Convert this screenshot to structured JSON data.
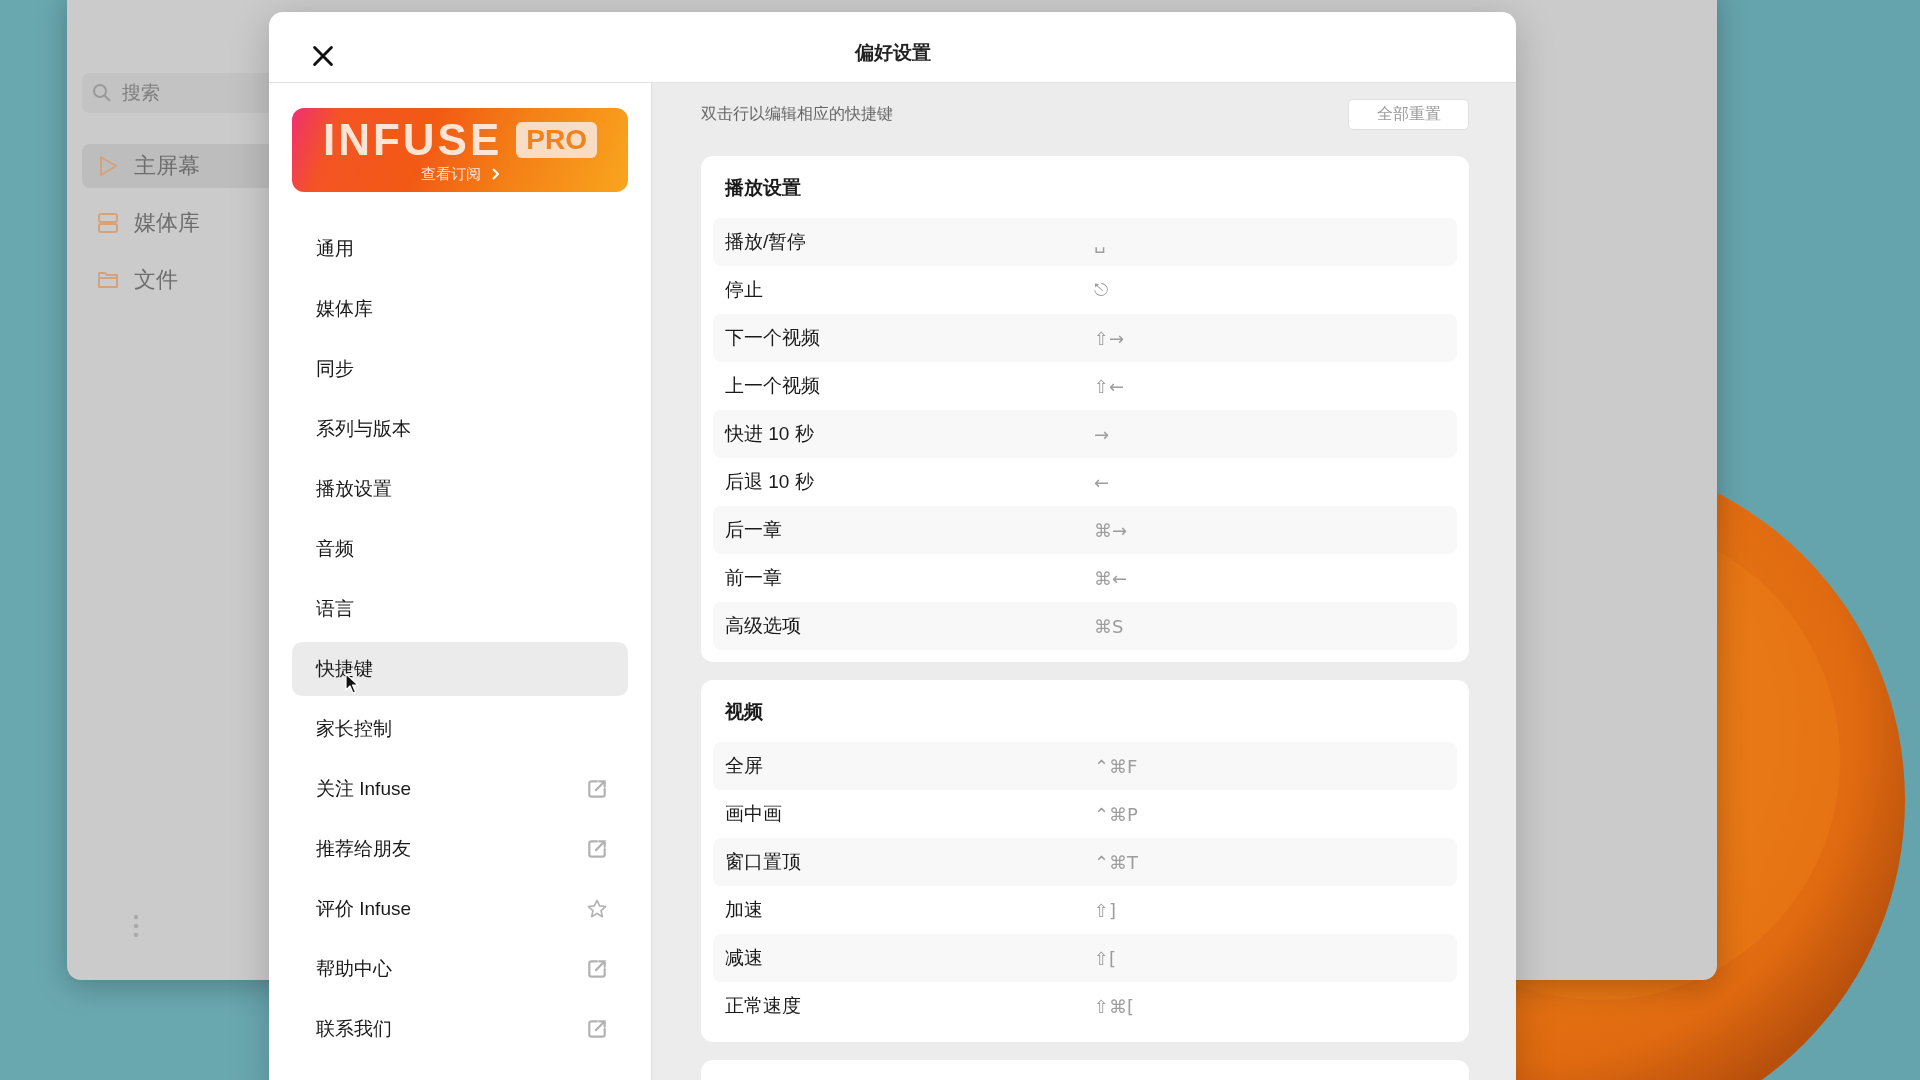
{
  "background_window": {
    "search": {
      "placeholder": "搜索"
    },
    "sidebar": {
      "items": [
        {
          "label": "主屏幕",
          "selected": true
        },
        {
          "label": "媒体库",
          "selected": false
        },
        {
          "label": "文件",
          "selected": false
        }
      ]
    }
  },
  "dialog": {
    "title": "偏好设置",
    "promo": {
      "logo": "INFUSE",
      "badge": "PRO",
      "link": "查看订阅"
    },
    "menu": [
      {
        "label": "通用",
        "selected": false,
        "kind": "page"
      },
      {
        "label": "媒体库",
        "selected": false,
        "kind": "page"
      },
      {
        "label": "同步",
        "selected": false,
        "kind": "page"
      },
      {
        "label": "系列与版本",
        "selected": false,
        "kind": "page"
      },
      {
        "label": "播放设置",
        "selected": false,
        "kind": "page"
      },
      {
        "label": "音频",
        "selected": false,
        "kind": "page"
      },
      {
        "label": "语言",
        "selected": false,
        "kind": "page"
      },
      {
        "label": "快捷键",
        "selected": true,
        "kind": "page"
      },
      {
        "label": "家长控制",
        "selected": false,
        "kind": "page"
      },
      {
        "label": "关注 Infuse",
        "selected": false,
        "kind": "link"
      },
      {
        "label": "推荐给朋友",
        "selected": false,
        "kind": "link"
      },
      {
        "label": "评价 Infuse",
        "selected": false,
        "kind": "rating"
      },
      {
        "label": "帮助中心",
        "selected": false,
        "kind": "link"
      },
      {
        "label": "联系我们",
        "selected": false,
        "kind": "link"
      }
    ],
    "hint": "双击行以编辑相应的快捷键",
    "reset_button": "全部重置",
    "sections": [
      {
        "title": "播放设置",
        "rows": [
          {
            "action": "播放/暂停",
            "shortcut": "␣"
          },
          {
            "action": "停止",
            "shortcut": "⎋"
          },
          {
            "action": "下一个视频",
            "shortcut": "⇧→"
          },
          {
            "action": "上一个视频",
            "shortcut": "⇧←"
          },
          {
            "action": "快进 10 秒",
            "shortcut": "→"
          },
          {
            "action": "后退 10 秒",
            "shortcut": "←"
          },
          {
            "action": "后一章",
            "shortcut": "⌘→"
          },
          {
            "action": "前一章",
            "shortcut": "⌘←"
          },
          {
            "action": "高级选项",
            "shortcut": "⌘S"
          }
        ]
      },
      {
        "title": "视频",
        "rows": [
          {
            "action": "全屏",
            "shortcut": "⌃⌘F"
          },
          {
            "action": "画中画",
            "shortcut": "⌃⌘P"
          },
          {
            "action": "窗口置顶",
            "shortcut": "⌃⌘T"
          },
          {
            "action": "加速",
            "shortcut": "⇧]"
          },
          {
            "action": "减速",
            "shortcut": "⇧["
          },
          {
            "action": "正常速度",
            "shortcut": "⇧⌘["
          }
        ]
      }
    ],
    "more_section": true
  }
}
